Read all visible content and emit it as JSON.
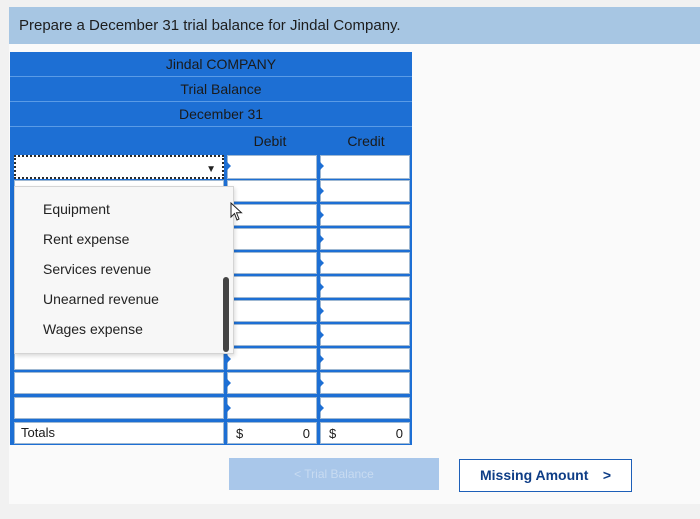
{
  "instruction": "Prepare a December 31 trial balance for Jindal Company.",
  "header": {
    "company": "Jindal COMPANY",
    "statement": "Trial Balance",
    "date": "December 31"
  },
  "columns": {
    "debit": "Debit",
    "credit": "Credit"
  },
  "dropdown": {
    "options": [
      "Equipment",
      "Rent expense",
      "Services revenue",
      "Unearned revenue",
      "Wages expense"
    ]
  },
  "totals": {
    "label": "Totals",
    "debit_currency": "$",
    "debit_amount": "0",
    "credit_currency": "$",
    "credit_amount": "0"
  },
  "nav": {
    "prev_label": "< Trial Balance",
    "next_label": "Missing Amount",
    "next_chevron": ">"
  },
  "colors": {
    "table_blue": "#1d6fd4",
    "instruction_bar": "#a7c6e3",
    "next_button_text": "#0e3d86"
  }
}
